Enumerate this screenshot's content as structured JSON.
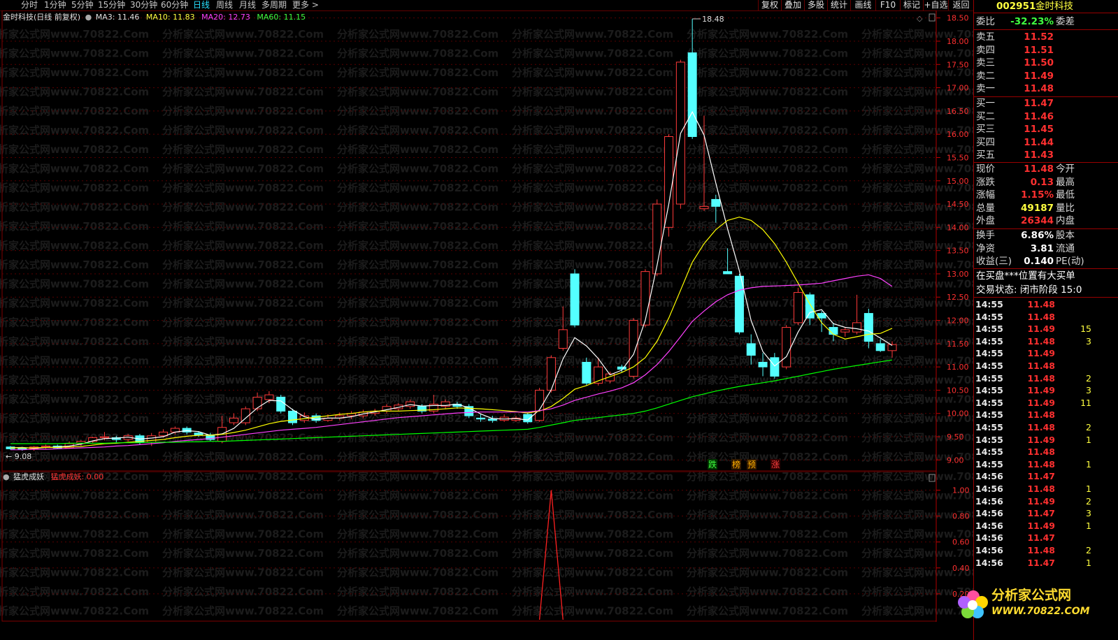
{
  "toolbar": {
    "timeframes": [
      "分时",
      "1分钟",
      "5分钟",
      "15分钟",
      "30分钟",
      "60分钟",
      "日线",
      "周线",
      "月线",
      "多周期",
      "更多 >"
    ],
    "active_index": 6,
    "right_buttons": [
      "复权",
      "叠加",
      "多股",
      "统计",
      "画线",
      "F10",
      "标记",
      "+自选",
      "返回"
    ]
  },
  "kline_header": {
    "name": "金时科技(日线 前复权)",
    "ma3": "MA3: 11.46",
    "ma10": "MA10: 11.83",
    "ma20": "MA20: 12.73",
    "ma60": "MA60: 11.15"
  },
  "indicator_header": {
    "name": "猛虎成妖",
    "value": "猛虎成妖: 0.00"
  },
  "watermark": "分析家公式网www.70822.Com",
  "signals": [
    "跌",
    "榜",
    "预",
    "涨"
  ],
  "panel": {
    "code": "002951",
    "name": "金时科技",
    "weibi_label": "委比",
    "weibi_value": "-32.23%",
    "weicha_label": "委差",
    "sells": [
      {
        "label": "卖五",
        "price": "11.52"
      },
      {
        "label": "卖四",
        "price": "11.51"
      },
      {
        "label": "卖三",
        "price": "11.50"
      },
      {
        "label": "卖二",
        "price": "11.49"
      },
      {
        "label": "卖一",
        "price": "11.48"
      }
    ],
    "buys": [
      {
        "label": "买一",
        "price": "11.47"
      },
      {
        "label": "买二",
        "price": "11.46"
      },
      {
        "label": "买三",
        "price": "11.45"
      },
      {
        "label": "买四",
        "price": "11.44"
      },
      {
        "label": "买五",
        "price": "11.43"
      }
    ],
    "quote": [
      {
        "l1": "现价",
        "v": "11.48",
        "l2": "今开",
        "c": "red"
      },
      {
        "l1": "涨跌",
        "v": "0.13",
        "l2": "最高",
        "c": "red"
      },
      {
        "l1": "涨幅",
        "v": "1.15%",
        "l2": "最低",
        "c": "red"
      },
      {
        "l1": "总量",
        "v": "49187",
        "l2": "量比",
        "c": "yel"
      },
      {
        "l1": "外盘",
        "v": "26344",
        "l2": "内盘",
        "c": "red"
      }
    ],
    "fund": [
      {
        "l1": "换手",
        "v": "6.86%",
        "l2": "股本"
      },
      {
        "l1": "净资",
        "v": "3.81",
        "l2": "流通"
      },
      {
        "l1": "收益(三)",
        "v": "0.140",
        "l2": "PE(动)"
      }
    ],
    "notice": "在买盘***位置有大买单",
    "status": "交易状态: 闭市阶段 15:0",
    "ticks": [
      {
        "t": "14:55",
        "p": "11.48",
        "v": ""
      },
      {
        "t": "14:55",
        "p": "11.48",
        "v": ""
      },
      {
        "t": "14:55",
        "p": "11.49",
        "v": "15"
      },
      {
        "t": "14:55",
        "p": "11.48",
        "v": "3"
      },
      {
        "t": "14:55",
        "p": "11.49",
        "v": ""
      },
      {
        "t": "14:55",
        "p": "11.48",
        "v": ""
      },
      {
        "t": "14:55",
        "p": "11.48",
        "v": "2"
      },
      {
        "t": "14:55",
        "p": "11.49",
        "v": "3"
      },
      {
        "t": "14:55",
        "p": "11.49",
        "v": "11"
      },
      {
        "t": "14:55",
        "p": "11.48",
        "v": ""
      },
      {
        "t": "14:55",
        "p": "11.48",
        "v": "2"
      },
      {
        "t": "14:55",
        "p": "11.49",
        "v": "1"
      },
      {
        "t": "14:55",
        "p": "11.48",
        "v": ""
      },
      {
        "t": "14:55",
        "p": "11.48",
        "v": "1"
      },
      {
        "t": "14:56",
        "p": "11.47",
        "v": ""
      },
      {
        "t": "14:56",
        "p": "11.48",
        "v": "1"
      },
      {
        "t": "14:56",
        "p": "11.49",
        "v": "2"
      },
      {
        "t": "14:56",
        "p": "11.47",
        "v": "3"
      },
      {
        "t": "14:56",
        "p": "11.49",
        "v": "1"
      },
      {
        "t": "14:56",
        "p": "11.47",
        "v": ""
      },
      {
        "t": "14:56",
        "p": "11.48",
        "v": "2"
      },
      {
        "t": "14:56",
        "p": "11.47",
        "v": "1"
      }
    ],
    "logo_cn": "分析家公式网",
    "logo_url": "WWW.70822.COM"
  },
  "chart_data": {
    "type": "candlestick",
    "ylim": [
      8.9,
      18.6
    ],
    "yticks": [
      "18.50",
      "18.00",
      "17.50",
      "17.00",
      "16.50",
      "16.00",
      "15.50",
      "15.00",
      "14.50",
      "14.00",
      "13.50",
      "13.00",
      "12.50",
      "12.00",
      "11.50",
      "11.00",
      "10.50",
      "10.00",
      "9.50",
      "9.00"
    ],
    "max_label": "18.48",
    "min_label": "9.08",
    "candles": [
      [
        9.28,
        9.24,
        9.3,
        9.22
      ],
      [
        9.25,
        9.24,
        9.28,
        9.2
      ],
      [
        9.24,
        9.28,
        9.3,
        9.2
      ],
      [
        9.28,
        9.3,
        9.33,
        9.24
      ],
      [
        9.3,
        9.26,
        9.33,
        9.24
      ],
      [
        9.26,
        9.35,
        9.4,
        9.24
      ],
      [
        9.35,
        9.4,
        9.42,
        9.3
      ],
      [
        9.4,
        9.48,
        9.5,
        9.35
      ],
      [
        9.48,
        9.5,
        9.6,
        9.42
      ],
      [
        9.48,
        9.44,
        9.52,
        9.38
      ],
      [
        9.44,
        9.52,
        9.56,
        9.4
      ],
      [
        9.52,
        9.38,
        9.56,
        9.33
      ],
      [
        9.38,
        9.52,
        9.58,
        9.3
      ],
      [
        9.52,
        9.6,
        9.66,
        9.48
      ],
      [
        9.6,
        9.68,
        9.72,
        9.55
      ],
      [
        9.68,
        9.6,
        9.72,
        9.55
      ],
      [
        9.58,
        9.54,
        9.62,
        9.5
      ],
      [
        9.54,
        9.44,
        9.58,
        9.4
      ],
      [
        9.4,
        9.7,
        9.95,
        9.36
      ],
      [
        9.8,
        9.9,
        10.0,
        9.75
      ],
      [
        9.8,
        10.1,
        10.15,
        9.75
      ],
      [
        10.1,
        10.35,
        10.45,
        10.05
      ],
      [
        10.3,
        10.4,
        10.48,
        10.22
      ],
      [
        10.35,
        10.05,
        10.4,
        10.0
      ],
      [
        10.05,
        9.8,
        10.1,
        9.75
      ],
      [
        9.85,
        9.95,
        10.02,
        9.8
      ],
      [
        9.95,
        9.85,
        10.0,
        9.8
      ],
      [
        9.85,
        9.9,
        9.98,
        9.82
      ],
      [
        9.9,
        9.95,
        10.02,
        9.85
      ],
      [
        9.95,
        10.0,
        10.05,
        9.88
      ],
      [
        9.95,
        10.03,
        10.08,
        9.9
      ],
      [
        10.0,
        10.05,
        10.1,
        9.95
      ],
      [
        10.05,
        10.15,
        10.2,
        10.0
      ],
      [
        10.1,
        10.18,
        10.22,
        10.05
      ],
      [
        10.15,
        10.25,
        10.3,
        10.1
      ],
      [
        10.15,
        10.05,
        10.2,
        10.0
      ],
      [
        10.05,
        10.2,
        10.4,
        10.0
      ],
      [
        10.15,
        10.25,
        10.3,
        10.1
      ],
      [
        10.2,
        10.15,
        10.25,
        10.1
      ],
      [
        10.15,
        9.95,
        10.2,
        9.9
      ],
      [
        9.9,
        9.88,
        9.98,
        9.82
      ],
      [
        9.88,
        9.85,
        9.95,
        9.8
      ],
      [
        9.85,
        9.92,
        9.98,
        9.82
      ],
      [
        9.85,
        9.9,
        9.95,
        9.82
      ],
      [
        9.98,
        9.82,
        10.02,
        9.78
      ],
      [
        9.85,
        10.5,
        10.55,
        9.82
      ],
      [
        10.5,
        11.2,
        11.25,
        10.45
      ],
      [
        11.4,
        11.8,
        12.3,
        11.35
      ],
      [
        13.0,
        11.9,
        13.1,
        11.85
      ],
      [
        11.1,
        10.65,
        11.2,
        10.6
      ],
      [
        10.65,
        11.0,
        11.2,
        10.6
      ],
      [
        10.7,
        10.85,
        10.9,
        10.65
      ],
      [
        11.0,
        10.95,
        11.05,
        10.88
      ],
      [
        10.8,
        12.0,
        12.05,
        10.75
      ],
      [
        11.9,
        13.05,
        13.1,
        11.85
      ],
      [
        13.0,
        14.5,
        14.6,
        12.95
      ],
      [
        14.0,
        15.95,
        16.0,
        13.8
      ],
      [
        14.5,
        17.55,
        17.6,
        14.4
      ],
      [
        17.75,
        15.95,
        18.48,
        15.9
      ],
      [
        14.4,
        14.45,
        16.4,
        14.35
      ],
      [
        14.6,
        14.45,
        14.7,
        14.1
      ],
      [
        13.05,
        13.0,
        13.55,
        13.0
      ],
      [
        12.95,
        11.75,
        13.0,
        11.7
      ],
      [
        11.5,
        11.25,
        11.7,
        11.05
      ],
      [
        11.1,
        11.0,
        11.3,
        10.8
      ],
      [
        11.2,
        10.8,
        11.3,
        10.75
      ],
      [
        11.0,
        11.85,
        11.9,
        10.95
      ],
      [
        11.95,
        12.6,
        12.7,
        11.9
      ],
      [
        12.55,
        12.05,
        12.6,
        11.9
      ],
      [
        12.15,
        12.05,
        12.2,
        11.75
      ],
      [
        11.85,
        11.7,
        11.95,
        11.55
      ],
      [
        11.75,
        11.8,
        11.85,
        11.65
      ],
      [
        11.75,
        11.95,
        12.55,
        11.7
      ],
      [
        12.15,
        11.55,
        12.25,
        11.4
      ],
      [
        11.5,
        11.35,
        11.6,
        11.32
      ],
      [
        11.35,
        11.48,
        11.55,
        11.2
      ]
    ],
    "ma_series": [
      {
        "name": "MA3",
        "color": "#ffffff",
        "values": [
          9.26,
          9.27,
          9.25,
          9.27,
          9.28,
          9.3,
          9.34,
          9.41,
          9.46,
          9.47,
          9.49,
          9.45,
          9.47,
          9.5,
          9.6,
          9.63,
          9.61,
          9.53,
          9.56,
          9.68,
          9.9,
          10.12,
          10.28,
          10.27,
          10.08,
          9.93,
          9.87,
          9.9,
          9.9,
          9.93,
          9.99,
          10.03,
          10.08,
          10.13,
          10.19,
          10.16,
          10.17,
          10.17,
          10.2,
          10.12,
          9.99,
          9.89,
          9.88,
          9.89,
          9.86,
          10.08,
          10.51,
          11.17,
          11.63,
          11.45,
          11.18,
          10.83,
          10.93,
          11.27,
          12.0,
          13.18,
          14.5,
          16.02,
          16.48,
          15.98,
          14.95,
          13.97,
          13.07,
          12.0,
          11.33,
          11.02,
          11.22,
          11.75,
          12.17,
          12.23,
          11.93,
          11.85,
          11.82,
          11.77,
          11.62,
          11.46
        ]
      },
      {
        "name": "MA10",
        "color": "#ffff00",
        "values": [
          9.26,
          9.26,
          9.26,
          9.27,
          9.27,
          9.28,
          9.29,
          9.32,
          9.35,
          9.36,
          9.38,
          9.4,
          9.42,
          9.44,
          9.48,
          9.51,
          9.53,
          9.53,
          9.55,
          9.59,
          9.64,
          9.71,
          9.78,
          9.83,
          9.86,
          9.89,
          9.92,
          9.95,
          9.98,
          10.0,
          10.03,
          10.05,
          10.05,
          10.05,
          10.06,
          10.07,
          10.08,
          10.1,
          10.12,
          10.11,
          10.1,
          10.08,
          10.06,
          10.04,
          10.01,
          10.05,
          10.15,
          10.32,
          10.52,
          10.6,
          10.7,
          10.79,
          10.88,
          11.0,
          11.2,
          11.55,
          12.05,
          12.65,
          13.25,
          13.65,
          13.95,
          14.15,
          14.22,
          14.15,
          13.95,
          13.65,
          13.25,
          12.8,
          12.35,
          11.95,
          11.7,
          11.6,
          11.65,
          11.7,
          11.72,
          11.83
        ]
      },
      {
        "name": "MA20",
        "color": "#ff40ff",
        "values": [
          9.22,
          9.22,
          9.23,
          9.23,
          9.24,
          9.25,
          9.26,
          9.27,
          9.28,
          9.3,
          9.31,
          9.33,
          9.35,
          9.37,
          9.4,
          9.42,
          9.44,
          9.46,
          9.49,
          9.52,
          9.55,
          9.58,
          9.61,
          9.64,
          9.66,
          9.68,
          9.7,
          9.73,
          9.76,
          9.79,
          9.82,
          9.85,
          9.88,
          9.91,
          9.93,
          9.95,
          9.97,
          9.99,
          10.01,
          10.02,
          10.03,
          10.03,
          10.03,
          10.03,
          10.03,
          10.06,
          10.1,
          10.18,
          10.28,
          10.35,
          10.42,
          10.48,
          10.55,
          10.66,
          10.83,
          11.05,
          11.33,
          11.65,
          11.98,
          12.2,
          12.4,
          12.55,
          12.65,
          12.7,
          12.73,
          12.74,
          12.75,
          12.76,
          12.78,
          12.8,
          12.85,
          12.9,
          12.95,
          12.98,
          12.9,
          12.73
        ]
      },
      {
        "name": "MA60",
        "color": "#00ff00",
        "values": [
          9.35,
          9.35,
          9.35,
          9.35,
          9.35,
          9.36,
          9.36,
          9.36,
          9.36,
          9.37,
          9.37,
          9.37,
          9.38,
          9.38,
          9.38,
          9.39,
          9.39,
          9.4,
          9.4,
          9.41,
          9.42,
          9.43,
          9.44,
          9.45,
          9.46,
          9.47,
          9.48,
          9.49,
          9.5,
          9.51,
          9.52,
          9.53,
          9.54,
          9.55,
          9.56,
          9.57,
          9.58,
          9.59,
          9.6,
          9.61,
          9.62,
          9.63,
          9.64,
          9.65,
          9.66,
          9.7,
          9.75,
          9.8,
          9.85,
          9.88,
          9.91,
          9.94,
          9.97,
          10.0,
          10.05,
          10.12,
          10.2,
          10.28,
          10.36,
          10.42,
          10.48,
          10.53,
          10.58,
          10.62,
          10.66,
          10.7,
          10.75,
          10.8,
          10.85,
          10.9,
          10.95,
          10.99,
          11.03,
          11.07,
          11.11,
          11.15
        ]
      }
    ],
    "indicator": {
      "name": "猛虎成妖",
      "ylim": [
        0,
        1.1
      ],
      "yticks": [
        "1.00",
        "0.80",
        "0.60",
        "0.40",
        "0.20"
      ],
      "values_note": "signal 1 at candle 46, else 0",
      "signal_index": 46
    }
  }
}
